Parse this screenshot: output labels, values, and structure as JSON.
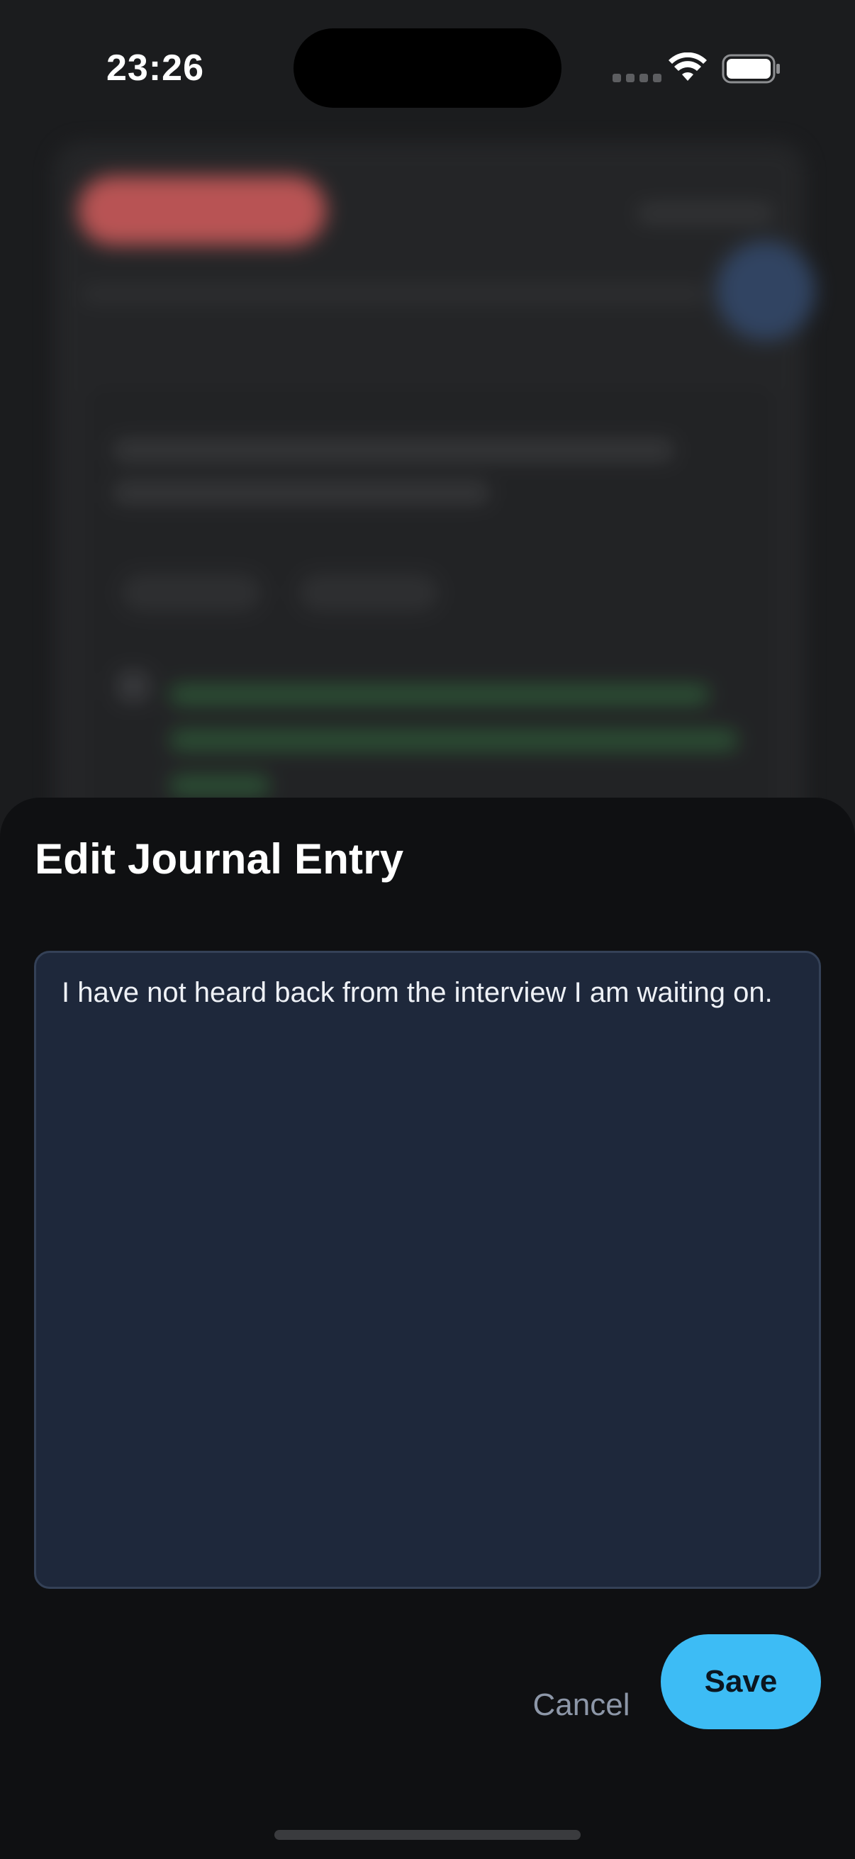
{
  "status_bar": {
    "time": "23:26",
    "wifi_icon": "wifi-icon",
    "battery_icon": "battery-full-icon"
  },
  "sheet": {
    "title": "Edit Journal Entry",
    "entry_text": "I have not heard back from the interview I am waiting on.",
    "cancel_label": "Cancel",
    "save_label": "Save"
  },
  "colors": {
    "sheet_background": "#0f1012",
    "textarea_background": "#1e283b",
    "accent": "#3dbcf5",
    "cancel_text": "#8d97a8"
  }
}
